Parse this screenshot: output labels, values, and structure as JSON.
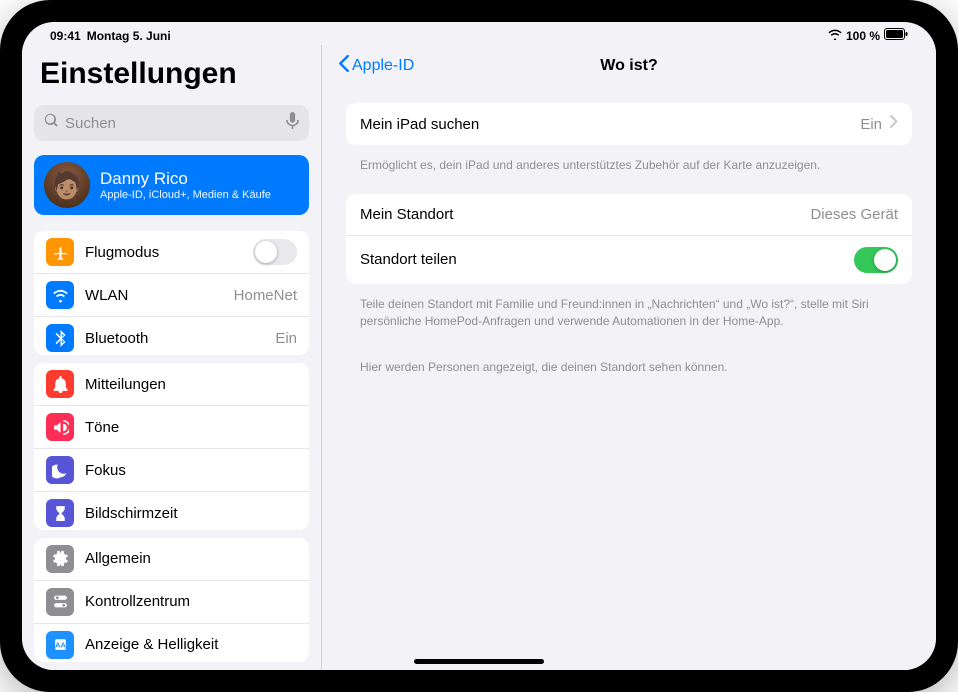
{
  "status": {
    "time": "09:41",
    "date": "Montag 5. Juni",
    "battery": "100 %"
  },
  "sidebar": {
    "title": "Einstellungen",
    "search_placeholder": "Suchen",
    "profile": {
      "name": "Danny Rico",
      "subtitle": "Apple-ID, iCloud+, Medien & Käufe"
    },
    "group1": {
      "airplane": "Flugmodus",
      "wifi": "WLAN",
      "wifi_value": "HomeNet",
      "bluetooth": "Bluetooth",
      "bluetooth_value": "Ein"
    },
    "group2": {
      "notifications": "Mitteilungen",
      "sounds": "Töne",
      "focus": "Fokus",
      "screentime": "Bildschirmzeit"
    },
    "group3": {
      "general": "Allgemein",
      "control": "Kontrollzentrum",
      "display": "Anzeige & Helligkeit"
    }
  },
  "detail": {
    "back": "Apple-ID",
    "title": "Wo ist?",
    "find_ipad": {
      "label": "Mein iPad suchen",
      "value": "Ein"
    },
    "find_caption": "Ermöglicht es, dein iPad und anderes unterstütztes Zubehör auf der Karte anzuzeigen.",
    "my_location": {
      "label": "Mein Standort",
      "value": "Dieses Gerät"
    },
    "share_location": "Standort teilen",
    "share_caption": "Teile deinen Standort mit Familie und Freund:innen in „Nachrichten“ und „Wo ist?“, stelle mit Siri persönliche HomePod-Anfragen und verwende Automationen in der Home-App.",
    "people_caption": "Hier werden Personen angezeigt, die deinen Standort sehen können."
  }
}
